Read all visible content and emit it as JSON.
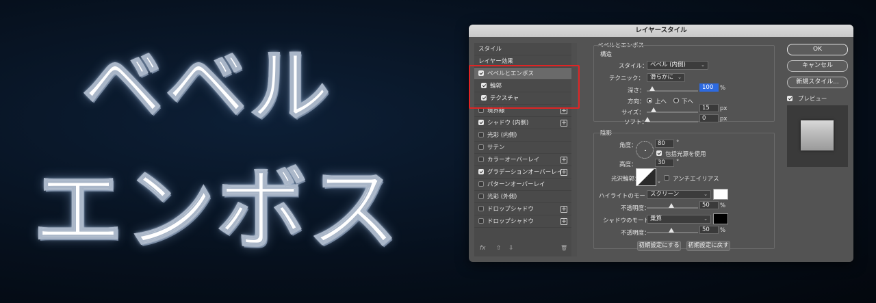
{
  "artwork": {
    "line1": "ベベル",
    "line2": "エンボス"
  },
  "dialog": {
    "title": "レイヤースタイル",
    "left_panel": {
      "items": [
        {
          "label": "スタイル",
          "checkbox": false,
          "checked": false,
          "plus": false,
          "selected": false,
          "sub": false
        },
        {
          "label": "レイヤー効果",
          "checkbox": false,
          "checked": false,
          "plus": false,
          "selected": false,
          "sub": false
        },
        {
          "label": "ベベルとエンボス",
          "checkbox": true,
          "checked": true,
          "plus": false,
          "selected": true,
          "sub": false
        },
        {
          "label": "輪郭",
          "checkbox": true,
          "checked": true,
          "plus": false,
          "selected": false,
          "sub": true
        },
        {
          "label": "テクスチャ",
          "checkbox": true,
          "checked": true,
          "plus": false,
          "selected": false,
          "sub": true
        },
        {
          "label": "境界線",
          "checkbox": true,
          "checked": false,
          "plus": true,
          "selected": false,
          "sub": false
        },
        {
          "label": "シャドウ (内側)",
          "checkbox": true,
          "checked": true,
          "plus": true,
          "selected": false,
          "sub": false
        },
        {
          "label": "光彩 (内側)",
          "checkbox": true,
          "checked": false,
          "plus": false,
          "selected": false,
          "sub": false
        },
        {
          "label": "サテン",
          "checkbox": true,
          "checked": false,
          "plus": false,
          "selected": false,
          "sub": false
        },
        {
          "label": "カラーオーバーレイ",
          "checkbox": true,
          "checked": false,
          "plus": true,
          "selected": false,
          "sub": false
        },
        {
          "label": "グラデーションオーバーレイ",
          "checkbox": true,
          "checked": true,
          "plus": true,
          "selected": false,
          "sub": false
        },
        {
          "label": "パターンオーバーレイ",
          "checkbox": true,
          "checked": false,
          "plus": false,
          "selected": false,
          "sub": false
        },
        {
          "label": "光彩 (外側)",
          "checkbox": true,
          "checked": false,
          "plus": false,
          "selected": false,
          "sub": false
        },
        {
          "label": "ドロップシャドウ",
          "checkbox": true,
          "checked": false,
          "plus": true,
          "selected": false,
          "sub": false
        },
        {
          "label": "ドロップシャドウ",
          "checkbox": true,
          "checked": false,
          "plus": true,
          "selected": false,
          "sub": false
        }
      ],
      "footer": {
        "fx": "fx",
        "up": "⇧",
        "down": "⇩",
        "trash": "🗑"
      }
    },
    "bevel": {
      "section_title": "ベベルとエンボス",
      "structure_title": "構造",
      "style_label": "スタイル：",
      "style_value": "ベベル (内側)",
      "technique_label": "テクニック：",
      "technique_value": "滑らかに",
      "depth_label": "深さ：",
      "depth_value": "100",
      "depth_percent": 100,
      "depth_unit": "%",
      "direction_label": "方向：",
      "direction_up": "上へ",
      "direction_down": "下へ",
      "size_label": "サイズ：",
      "size_value": "15",
      "size_unit": "px",
      "soften_label": "ソフト：",
      "soften_value": "0",
      "soften_unit": "px"
    },
    "shading": {
      "title": "陰影",
      "angle_label": "角度：",
      "angle_value": "80",
      "angle_unit": "°",
      "global_light_label": "包括光源を使用",
      "altitude_label": "高度：",
      "altitude_value": "30",
      "altitude_unit": "°",
      "gloss_label": "光沢輪郭：",
      "antialias_label": "アンチエイリアス",
      "highlight_mode_label": "ハイライトのモード：",
      "highlight_mode_value": "スクリーン",
      "highlight_color": "#ffffff",
      "highlight_opacity_label": "不透明度：",
      "highlight_opacity_value": "50",
      "highlight_opacity_percent": 50,
      "shadow_mode_label": "シャドウのモード：",
      "shadow_mode_value": "乗算",
      "shadow_color": "#000000",
      "shadow_opacity_label": "不透明度：",
      "shadow_opacity_value": "50",
      "shadow_opacity_percent": 50,
      "percent": "%"
    },
    "buttons": {
      "make_default": "初期設定にする",
      "reset_default": "初期設定に戻す",
      "ok": "OK",
      "cancel": "キャンセル",
      "new_style": "新規スタイル...",
      "preview": "プレビュー"
    }
  },
  "colors": {
    "highlight_box": "#e02424",
    "selection": "#2d6ae0"
  }
}
